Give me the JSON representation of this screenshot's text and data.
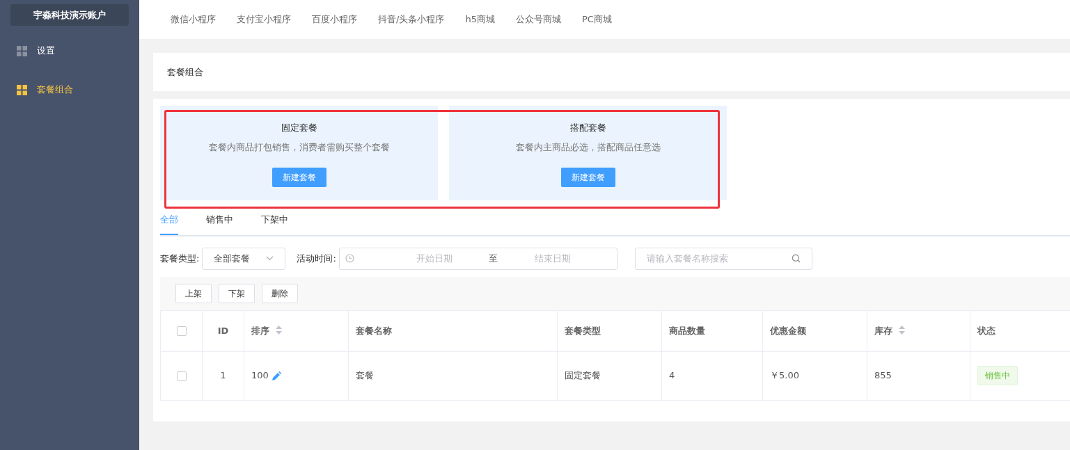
{
  "sidebar": {
    "account": "宇淼科技演示账户",
    "items": [
      {
        "label": "设置",
        "selected": false
      },
      {
        "label": "套餐组合",
        "selected": true
      }
    ]
  },
  "top_tabs": [
    {
      "label": "微信小程序"
    },
    {
      "label": "支付宝小程序"
    },
    {
      "label": "百度小程序"
    },
    {
      "label": "抖音/头条小程序"
    },
    {
      "label": "h5商城"
    },
    {
      "label": "公众号商城"
    },
    {
      "label": "PC商城"
    }
  ],
  "panel_title": "套餐组合",
  "package_types": [
    {
      "title": "固定套餐",
      "description": "套餐内商品打包销售，消费者需购买整个套餐",
      "button": "新建套餐"
    },
    {
      "title": "搭配套餐",
      "description": "套餐内主商品必选，搭配商品任意选",
      "button": "新建套餐"
    }
  ],
  "status_tabs": [
    {
      "label": "全部",
      "selected": true
    },
    {
      "label": "销售中",
      "selected": false
    },
    {
      "label": "下架中",
      "selected": false
    }
  ],
  "filters": {
    "type_label": "套餐类型:",
    "type_value": "全部套餐",
    "time_label": "活动时间:",
    "start_placeholder": "开始日期",
    "separator": "至",
    "end_placeholder": "结束日期",
    "search_placeholder": "请输入套餐名称搜索"
  },
  "bulk_buttons": [
    "上架",
    "下架",
    "删除"
  ],
  "table": {
    "header_checked": false,
    "columns": [
      {
        "label": "ID",
        "sortable": false
      },
      {
        "label": "排序",
        "sortable": true
      },
      {
        "label": "套餐名称",
        "sortable": false
      },
      {
        "label": "套餐类型",
        "sortable": false
      },
      {
        "label": "商品数量",
        "sortable": false
      },
      {
        "label": "优惠金额",
        "sortable": false
      },
      {
        "label": "库存",
        "sortable": true
      },
      {
        "label": "状态",
        "sortable": false
      }
    ],
    "rows": [
      {
        "checked": false,
        "id": "1",
        "sort": "100",
        "name": "套餐",
        "type": "固定套餐",
        "count": "4",
        "discount": "￥5.00",
        "stock": "855",
        "status": "销售中"
      }
    ]
  }
}
